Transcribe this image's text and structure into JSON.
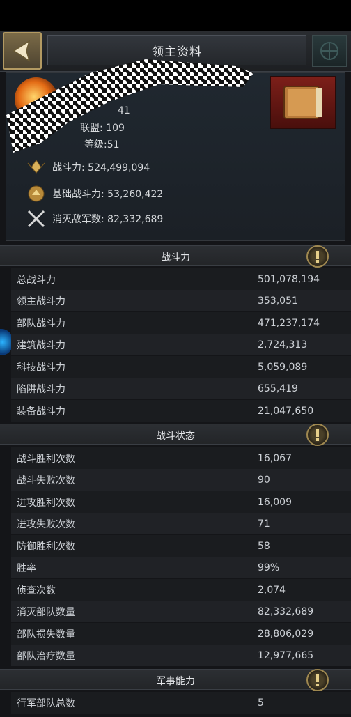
{
  "header": {
    "title": "领主资料"
  },
  "profile": {
    "line1_value": "41",
    "line2_suffix": "联盟: 109",
    "level": "等级:51",
    "power": "战斗力: 524,499,094",
    "base_power": "基础战斗力: 53,260,422",
    "enemies_destroyed": "消灭敌军数: 82,332,689"
  },
  "sections": {
    "combat_power": {
      "title": "战斗力",
      "rows": [
        {
          "label": "总战斗力",
          "value": "501,078,194"
        },
        {
          "label": "领主战斗力",
          "value": "353,051"
        },
        {
          "label": "部队战斗力",
          "value": "471,237,174"
        },
        {
          "label": "建筑战斗力",
          "value": "2,724,313"
        },
        {
          "label": "科技战斗力",
          "value": "5,059,089"
        },
        {
          "label": "陷阱战斗力",
          "value": "655,419"
        },
        {
          "label": "装备战斗力",
          "value": "21,047,650"
        }
      ]
    },
    "battle_status": {
      "title": "战斗状态",
      "rows": [
        {
          "label": "战斗胜利次数",
          "value": "16,067"
        },
        {
          "label": "战斗失败次数",
          "value": "90"
        },
        {
          "label": "进攻胜利次数",
          "value": "16,009"
        },
        {
          "label": "进攻失败次数",
          "value": "71"
        },
        {
          "label": "防御胜利次数",
          "value": "58"
        },
        {
          "label": "胜率",
          "value": "99%"
        },
        {
          "label": "侦查次数",
          "value": "2,074"
        },
        {
          "label": "消灭部队数量",
          "value": "82,332,689"
        },
        {
          "label": "部队损失数量",
          "value": "28,806,029"
        },
        {
          "label": "部队治疗数量",
          "value": "12,977,665"
        }
      ]
    },
    "military": {
      "title": "军事能力",
      "rows": [
        {
          "label": "行军部队总数",
          "value": "5"
        }
      ]
    }
  },
  "icons": {
    "back": "back-arrow-icon",
    "info": "exclamation-icon",
    "power": "power-emblem-icon",
    "base_power": "base-power-emblem-icon",
    "crossed_swords": "crossed-swords-icon",
    "book": "book-icon"
  }
}
